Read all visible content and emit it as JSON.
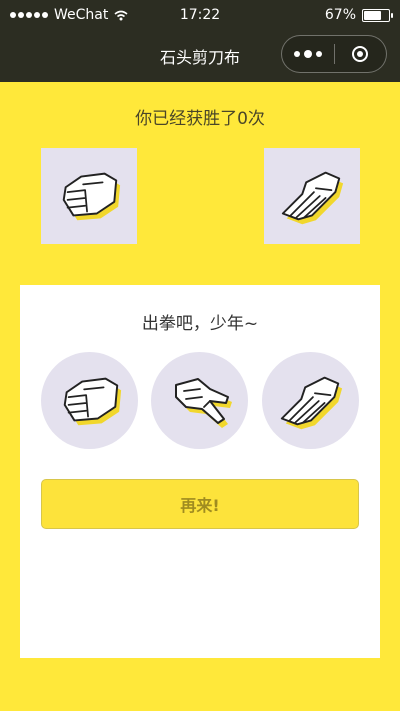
{
  "status_bar": {
    "carrier": "WeChat",
    "time": "17:22",
    "battery": "67%",
    "battery_level": 0.67
  },
  "nav": {
    "title": "石头剪刀布",
    "more_icon": "more-dots-icon",
    "close_icon": "mini-program-close-icon"
  },
  "game": {
    "wins_text": "你已经获胜了0次",
    "player_hand": "rock",
    "computer_hand": "paper",
    "prompt": "出拳吧，少年~",
    "choices": [
      {
        "name": "rock",
        "icon": "rock-hand-icon"
      },
      {
        "name": "scissors",
        "icon": "scissors-hand-icon"
      },
      {
        "name": "paper",
        "icon": "paper-hand-icon"
      }
    ],
    "again_label": "再来!"
  },
  "colors": {
    "background": "#ffe83a",
    "nav_bar": "#2c2d22",
    "card": "#e4e1ee",
    "button": "#fde33b",
    "button_text": "#a08c20"
  }
}
